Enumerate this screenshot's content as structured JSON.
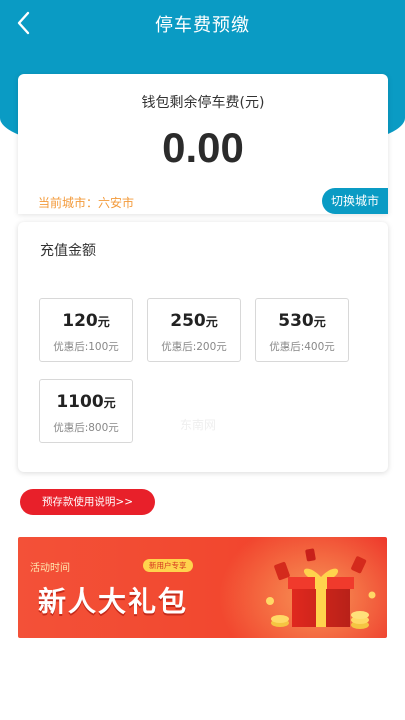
{
  "header": {
    "title": "停车费预缴"
  },
  "wallet": {
    "label": "钱包剩余停车费(元)",
    "amount": "0.00",
    "city": "当前城市：六安市",
    "switch_city_label": "切换城市"
  },
  "recharge": {
    "title": "充值金额",
    "options": [
      {
        "amount": "120",
        "unit": "元",
        "discount": "优惠后:100元"
      },
      {
        "amount": "250",
        "unit": "元",
        "discount": "优惠后:200元"
      },
      {
        "amount": "530",
        "unit": "元",
        "discount": "优惠后:400元"
      },
      {
        "amount": "1100",
        "unit": "元",
        "discount": "优惠后:800元"
      }
    ],
    "watermark": "东南网"
  },
  "instructions_button": {
    "label": "预存款使用说明>>"
  },
  "banner": {
    "subtitle": "活动时间",
    "title": "新人大礼包",
    "badge": "新用户专享"
  },
  "colors": {
    "header": "#0a9bc4",
    "accent_orange": "#f39a3a",
    "button_red": "#e8202a",
    "banner_red": "#f2482f"
  },
  "icons": {
    "back": "chevron-left-icon",
    "gift": "gift-box-icon"
  }
}
